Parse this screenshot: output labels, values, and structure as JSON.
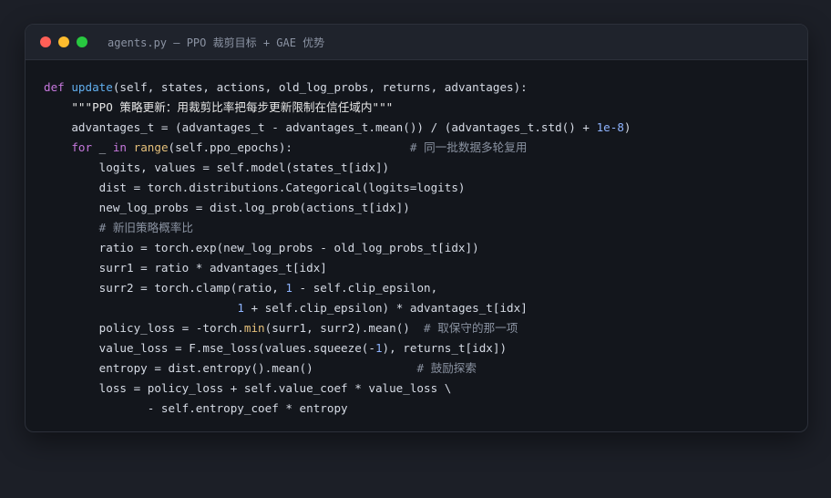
{
  "window": {
    "title": "agents.py — PPO 裁剪目标 + GAE 优势",
    "controls": [
      "close",
      "minimize",
      "maximize"
    ]
  },
  "colors": {
    "background": "#1c1f27",
    "panel": "#13161c",
    "keyword": "#c678dd",
    "function": "#61afef",
    "builtin": "#e5c07b",
    "number": "#8fb4ff",
    "comment": "#8a92a1",
    "text": "#d6dbe5"
  },
  "code": {
    "language": "python",
    "lines": [
      [
        [
          "kw",
          "def"
        ],
        [
          "var",
          " "
        ],
        [
          "fn",
          "update"
        ],
        [
          "var",
          "(self, states, actions, old_log_probs, returns, advantages):"
        ]
      ],
      [
        [
          "var",
          "    "
        ],
        [
          "str",
          "\"\"\"PPO 策略更新：用裁剪比率把每步更新限制在信任域内\"\"\""
        ]
      ],
      [
        [
          "var",
          "    advantages_t = (advantages_t - advantages_t.mean()) / (advantages_t.std() + "
        ],
        [
          "num",
          "1e-8"
        ],
        [
          "var",
          ")"
        ]
      ],
      [
        [
          "var",
          "    "
        ],
        [
          "kw",
          "for"
        ],
        [
          "var",
          " _ "
        ],
        [
          "kw",
          "in"
        ],
        [
          "var",
          " "
        ],
        [
          "bi",
          "range"
        ],
        [
          "var",
          "(self.ppo_epochs):                 "
        ],
        [
          "cm",
          "# 同一批数据多轮复用"
        ]
      ],
      [
        [
          "var",
          "        logits, values = self.model(states_t[idx])"
        ]
      ],
      [
        [
          "var",
          "        dist = torch.distributions.Categorical(logits=logits)"
        ]
      ],
      [
        [
          "var",
          "        new_log_probs = dist.log_prob(actions_t[idx])"
        ]
      ],
      [
        [
          "var",
          "        "
        ],
        [
          "cm",
          "# 新旧策略概率比"
        ]
      ],
      [
        [
          "var",
          "        ratio = torch.exp(new_log_probs - old_log_probs_t[idx])"
        ]
      ],
      [
        [
          "var",
          "        surr1 = ratio * advantages_t[idx]"
        ]
      ],
      [
        [
          "var",
          "        surr2 = torch.clamp(ratio, "
        ],
        [
          "num",
          "1"
        ],
        [
          "var",
          " - self.clip_epsilon,"
        ]
      ],
      [
        [
          "var",
          "                            "
        ],
        [
          "num",
          "1"
        ],
        [
          "var",
          " + self.clip_epsilon) * advantages_t[idx]"
        ]
      ],
      [
        [
          "var",
          "        policy_loss = -torch."
        ],
        [
          "bi",
          "min"
        ],
        [
          "var",
          "(surr1, surr2).mean()  "
        ],
        [
          "cm",
          "# 取保守的那一项"
        ]
      ],
      [
        [
          "var",
          "        value_loss = F.mse_loss(values.squeeze(-"
        ],
        [
          "num",
          "1"
        ],
        [
          "var",
          "), returns_t[idx])"
        ]
      ],
      [
        [
          "var",
          "        entropy = dist.entropy().mean()               "
        ],
        [
          "cm",
          "# 鼓励探索"
        ]
      ],
      [
        [
          "var",
          "        loss = policy_loss + self.value_coef * value_loss \\"
        ]
      ],
      [
        [
          "var",
          "               - self.entropy_coef * entropy"
        ]
      ]
    ]
  }
}
